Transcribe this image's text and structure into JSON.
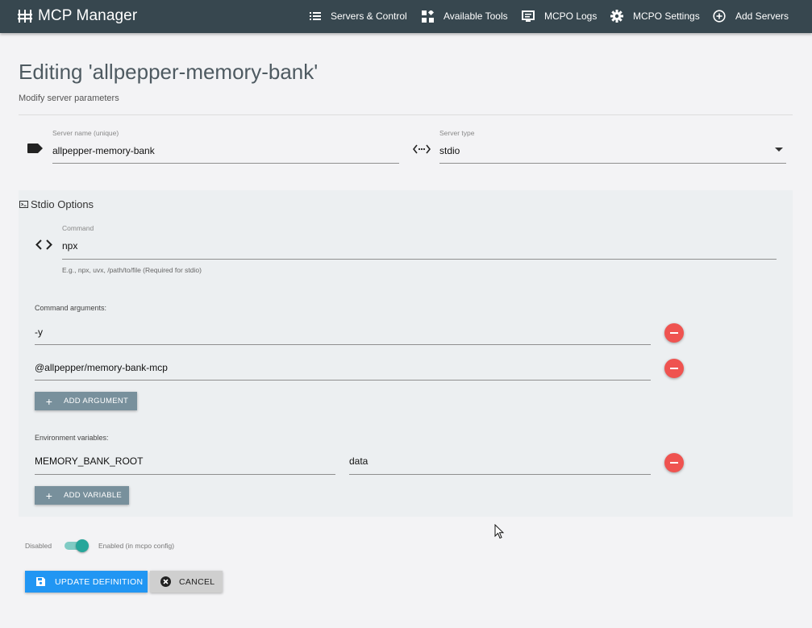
{
  "app": {
    "title": "MCP Manager",
    "icon": "server-grid-icon",
    "colors": {
      "topbar": "#37474f",
      "primary": "#2196f3",
      "danger": "#ef5350",
      "secondary": "#78909c",
      "toggle": "#26a69a"
    }
  },
  "nav": [
    {
      "label": "Servers & Control",
      "icon": "list-icon"
    },
    {
      "label": "Available Tools",
      "icon": "widgets-icon"
    },
    {
      "label": "MCPO Logs",
      "icon": "terminal-window-icon"
    },
    {
      "label": "MCPO Settings",
      "icon": "gear-icon"
    },
    {
      "label": "Add Servers",
      "icon": "plus-circle-icon"
    }
  ],
  "page": {
    "title": "Editing 'allpepper-memory-bank'",
    "subtitle": "Modify server parameters"
  },
  "form": {
    "server_name": {
      "label": "Server name (unique)",
      "value": "allpepper-memory-bank",
      "icon": "label-tag-icon"
    },
    "server_type": {
      "label": "Server type",
      "value": "stdio",
      "icon": "code-dots-icon"
    }
  },
  "stdio": {
    "title": "Stdio Options",
    "icon": "console-icon",
    "command": {
      "label": "Command",
      "value": "npx",
      "helper": "E.g., npx, uvx, /path/to/file (Required for stdio)",
      "icon": "code-brackets-icon"
    },
    "arguments_label": "Command arguments:",
    "arguments": [
      "-y",
      "@allpepper/memory-bank-mcp"
    ],
    "add_argument": "ADD ARGUMENT",
    "env_label": "Environment variables:",
    "env": [
      {
        "key": "MEMORY_BANK_ROOT",
        "value": "data"
      }
    ],
    "add_variable": "ADD VARIABLE"
  },
  "toggle": {
    "off_label": "Disabled",
    "on_label": "Enabled (in mcpo config)",
    "enabled": true
  },
  "actions": {
    "update": "UPDATE DEFINITION",
    "cancel": "CANCEL"
  }
}
